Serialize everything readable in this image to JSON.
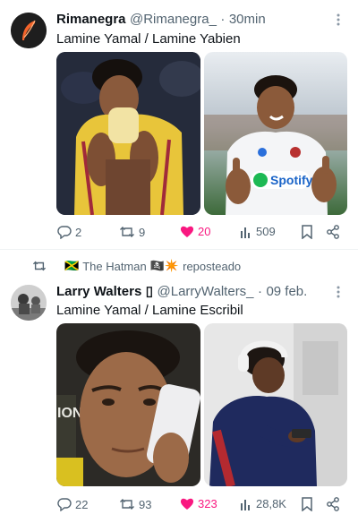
{
  "post1": {
    "author_name": "Rimanegra",
    "handle": "@Rimanegra_",
    "separator": "·",
    "time": "30min",
    "text": "Lamine Yamal  /  Lamine Yabien",
    "metrics": {
      "replies": "2",
      "reposts": "9",
      "likes": "20",
      "views": "509"
    }
  },
  "repost_bar": {
    "flag": "🇯🇲",
    "user": "The Hatman",
    "emojis": "🏴‍☠️✴️",
    "label": "reposteado"
  },
  "post2": {
    "author_name": "Larry Walters",
    "name_badge": "▯",
    "handle": "@LarryWalters_",
    "separator": "·",
    "time": "09 feb.",
    "text": "Lamine Yamal / Lamine Escribil",
    "metrics": {
      "replies": "22",
      "reposts": "93",
      "likes": "323",
      "views": "28,8K"
    }
  },
  "photo_text": {
    "jersey_sponsor": "Spotify",
    "billboard": "ION"
  },
  "colors": {
    "like_pink": "#f91880",
    "text_secondary": "#536471",
    "divider": "#eff3f4"
  }
}
